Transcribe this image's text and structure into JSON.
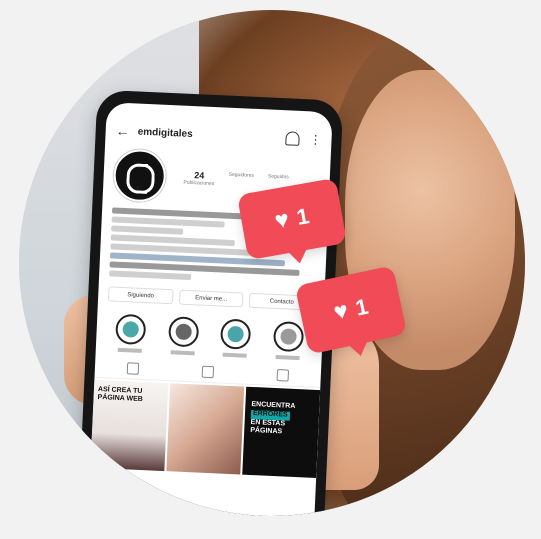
{
  "profile": {
    "username": "emdigitales",
    "stats": [
      {
        "num": "24",
        "lbl": "Publicaciones"
      },
      {
        "num": "",
        "lbl": "Seguidores"
      },
      {
        "num": "",
        "lbl": "Seguidos"
      }
    ]
  },
  "actions": {
    "follow_label": "Siguiendo",
    "message_label": "Enviar me...",
    "contact_label": "Contacto"
  },
  "posts": {
    "post1_text": "ASÍ CREA TU PÁGINA WEB",
    "post3_text_a": "ENCUENTRA",
    "post3_text_b": "ERRORES",
    "post3_text_c": "EN ESTAS PÁGINAS"
  },
  "likes": [
    {
      "count": "1"
    },
    {
      "count": "1"
    }
  ],
  "colors": {
    "like_badge": "#f04b57",
    "accent_teal": "#12a6a6"
  }
}
